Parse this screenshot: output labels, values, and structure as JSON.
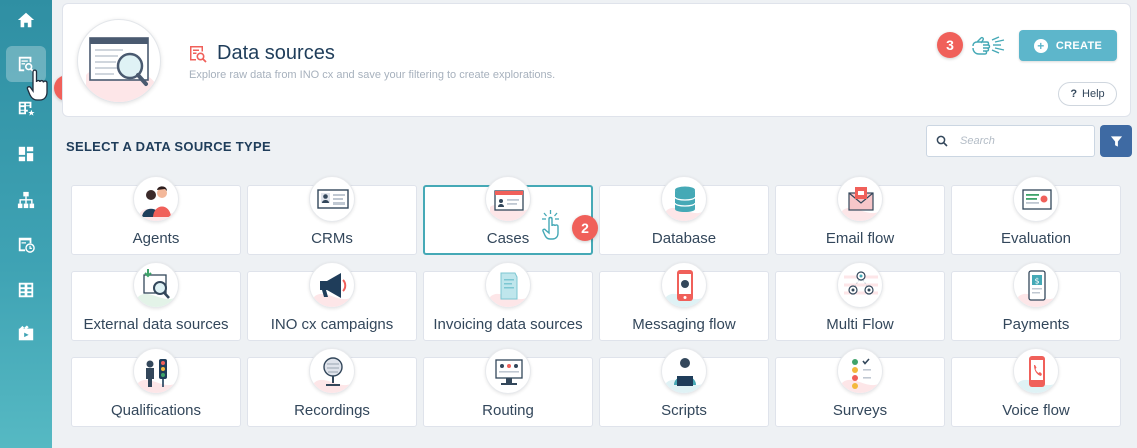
{
  "sidebar": {
    "items": [
      {
        "icon": "home-icon"
      },
      {
        "icon": "data-sources-icon",
        "active": true
      },
      {
        "icon": "table-star-icon"
      },
      {
        "icon": "dashboard-icon"
      },
      {
        "icon": "hierarchy-icon"
      },
      {
        "icon": "scheduled-report-icon"
      },
      {
        "icon": "grid-icon"
      },
      {
        "icon": "video-icon"
      }
    ]
  },
  "header": {
    "title": "Data sources",
    "subtitle": "Explore raw data from INO cx and save your filtering to create explorations.",
    "create_label": "CREATE",
    "help_label": "Help",
    "help_symbol": "?"
  },
  "badges": {
    "one": "1",
    "two": "2",
    "three": "3"
  },
  "section": {
    "title": "SELECT A DATA SOURCE TYPE",
    "search_placeholder": "Search"
  },
  "tiles": [
    {
      "label": "Agents",
      "icon": "agents-icon"
    },
    {
      "label": "CRMs",
      "icon": "crm-card-icon"
    },
    {
      "label": "Cases",
      "icon": "cases-icon",
      "selected": true
    },
    {
      "label": "Database",
      "icon": "database-icon"
    },
    {
      "label": "Email flow",
      "icon": "email-icon"
    },
    {
      "label": "Evaluation",
      "icon": "evaluation-icon"
    },
    {
      "label": "External data sources",
      "icon": "external-data-icon"
    },
    {
      "label": "INO cx campaigns",
      "icon": "megaphone-icon"
    },
    {
      "label": "Invoicing data sources",
      "icon": "invoice-icon"
    },
    {
      "label": "Messaging flow",
      "icon": "phone-chat-icon"
    },
    {
      "label": "Multi Flow",
      "icon": "multi-flow-icon"
    },
    {
      "label": "Payments",
      "icon": "payment-icon"
    },
    {
      "label": "Qualifications",
      "icon": "qualifications-icon"
    },
    {
      "label": "Recordings",
      "icon": "microphone-icon"
    },
    {
      "label": "Routing",
      "icon": "routing-icon"
    },
    {
      "label": "Scripts",
      "icon": "scripts-icon"
    },
    {
      "label": "Surveys",
      "icon": "survey-icon"
    },
    {
      "label": "Voice flow",
      "icon": "voice-phone-icon"
    }
  ],
  "colors": {
    "sidebar": "#3fa3b4",
    "accent": "#5db6cb",
    "badge": "#f0605a",
    "filter": "#3e6aa3",
    "selected_border": "#45a9b6"
  }
}
